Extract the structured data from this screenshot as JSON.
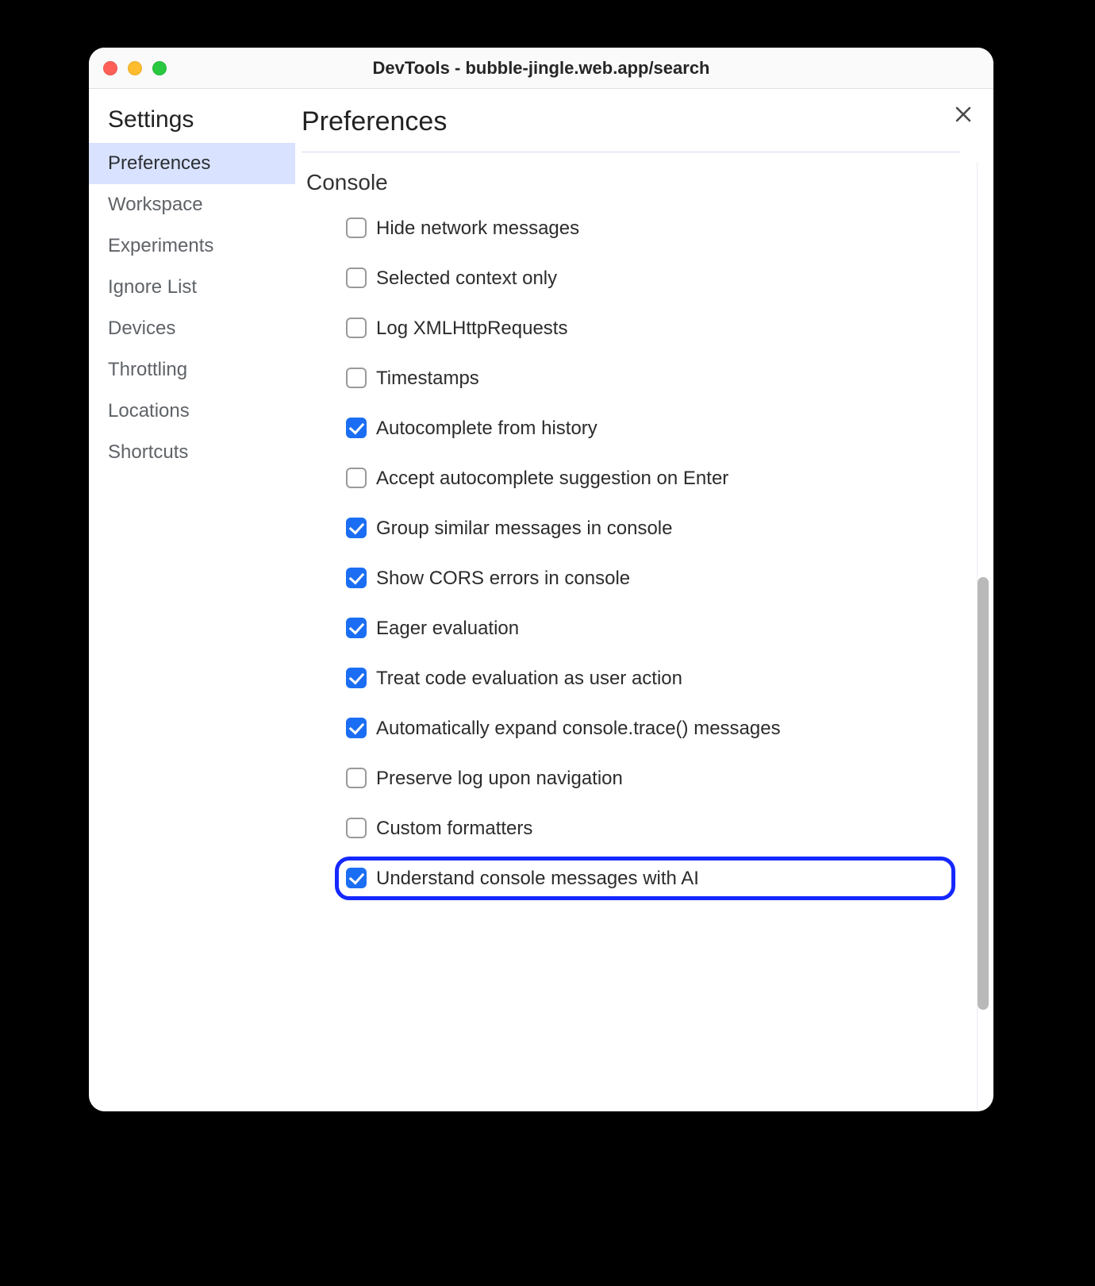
{
  "window": {
    "title": "DevTools - bubble-jingle.web.app/search"
  },
  "sidebar": {
    "title": "Settings",
    "items": [
      {
        "label": "Preferences",
        "active": true
      },
      {
        "label": "Workspace",
        "active": false
      },
      {
        "label": "Experiments",
        "active": false
      },
      {
        "label": "Ignore List",
        "active": false
      },
      {
        "label": "Devices",
        "active": false
      },
      {
        "label": "Throttling",
        "active": false
      },
      {
        "label": "Locations",
        "active": false
      },
      {
        "label": "Shortcuts",
        "active": false
      }
    ]
  },
  "main": {
    "title": "Preferences",
    "section": {
      "title": "Console",
      "options": [
        {
          "label": "Hide network messages",
          "checked": false,
          "highlighted": false
        },
        {
          "label": "Selected context only",
          "checked": false,
          "highlighted": false
        },
        {
          "label": "Log XMLHttpRequests",
          "checked": false,
          "highlighted": false
        },
        {
          "label": "Timestamps",
          "checked": false,
          "highlighted": false
        },
        {
          "label": "Autocomplete from history",
          "checked": true,
          "highlighted": false
        },
        {
          "label": "Accept autocomplete suggestion on Enter",
          "checked": false,
          "highlighted": false
        },
        {
          "label": "Group similar messages in console",
          "checked": true,
          "highlighted": false
        },
        {
          "label": "Show CORS errors in console",
          "checked": true,
          "highlighted": false
        },
        {
          "label": "Eager evaluation",
          "checked": true,
          "highlighted": false
        },
        {
          "label": "Treat code evaluation as user action",
          "checked": true,
          "highlighted": false
        },
        {
          "label": "Automatically expand console.trace() messages",
          "checked": true,
          "highlighted": false
        },
        {
          "label": "Preserve log upon navigation",
          "checked": false,
          "highlighted": false
        },
        {
          "label": "Custom formatters",
          "checked": false,
          "highlighted": false
        },
        {
          "label": "Understand console messages with AI",
          "checked": true,
          "highlighted": true
        }
      ]
    }
  }
}
